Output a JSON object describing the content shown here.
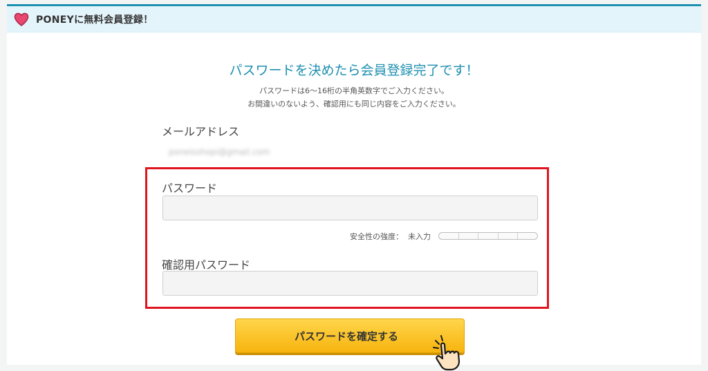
{
  "header": {
    "title": "PONEYに無料会員登録！",
    "icon": "heart-icon",
    "heart_color": "#e8476f"
  },
  "main": {
    "title": "パスワードを決めたら会員登録完了です！",
    "note_line1": "パスワードは6〜16桁の半角英数字でご入力ください。",
    "note_line2": "お間違いのないよう、確認用にも同じ内容をご入力ください。"
  },
  "email": {
    "label": "メールアドレス",
    "value": "poneisshopi@gmail.com"
  },
  "password": {
    "label": "パスワード",
    "value": "",
    "strength_label": "安全性の強度：",
    "strength_value": "未入力",
    "strength_fraction": 0
  },
  "confirm_password": {
    "label": "確認用パスワード",
    "value": ""
  },
  "submit": {
    "label": "パスワードを確定する",
    "color": "#f7b40f"
  },
  "theme": {
    "accent": "#1d8fb0",
    "highlight_border": "#e0141e"
  }
}
